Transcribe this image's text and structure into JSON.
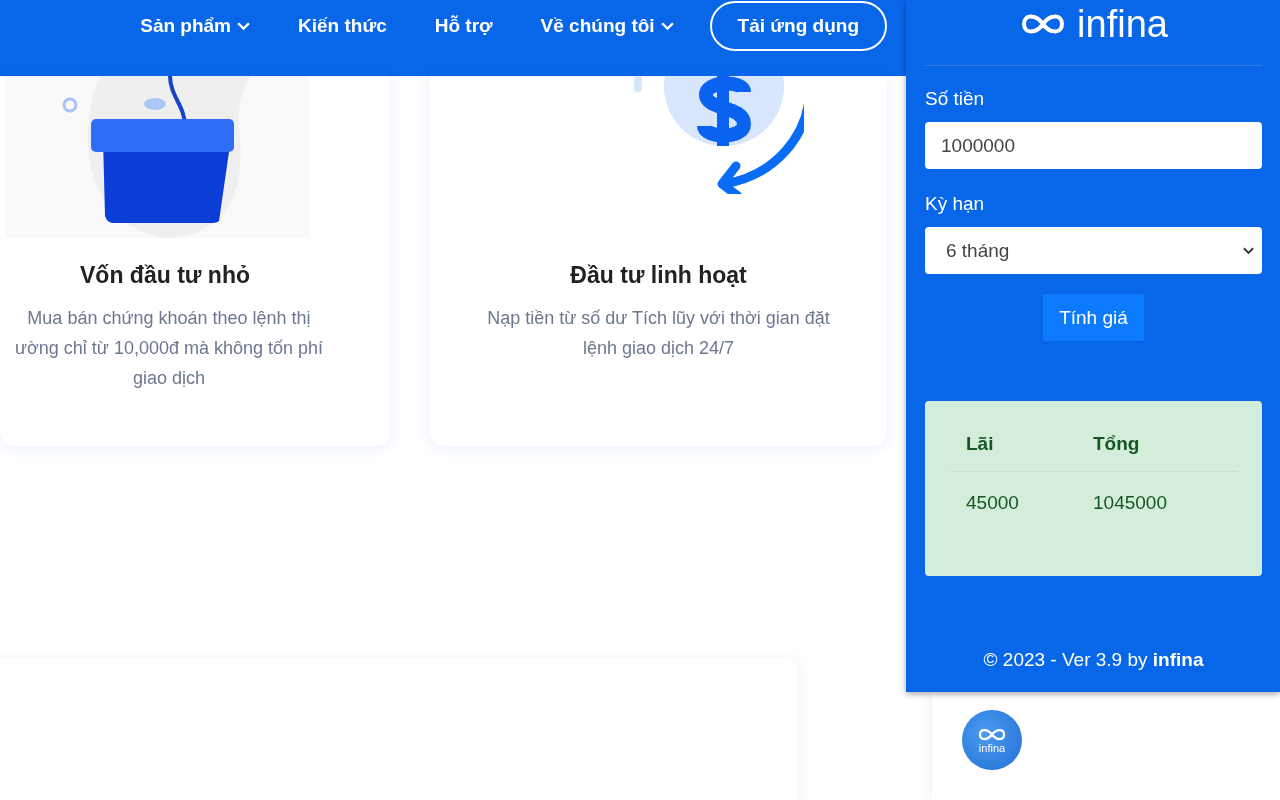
{
  "nav": {
    "items": [
      {
        "label": "Sản phẩm",
        "has_menu": true
      },
      {
        "label": "Kiến thức",
        "has_menu": false
      },
      {
        "label": "Hỗ trợ",
        "has_menu": false
      },
      {
        "label": "Về chúng tôi",
        "has_menu": true
      }
    ],
    "cta": "Tải ứng dụng"
  },
  "features": [
    {
      "kind": "pot",
      "title": "Vốn đầu tư nhỏ",
      "description_lines": [
        "Mua bán chứng khoán theo lệnh thị",
        "ường chỉ từ 10,000đ mà không tốn phí",
        "giao dịch"
      ]
    },
    {
      "kind": "coin",
      "title": "Đầu tư linh hoạt",
      "description_lines": [
        "Nạp tiền từ số dư Tích lũy với thời gian đặt",
        "lệnh giao dịch 24/7"
      ]
    }
  ],
  "avatar": {
    "label": "infina"
  },
  "calculator": {
    "brand": "infina",
    "amount": {
      "label": "Số tiền",
      "value": "1000000"
    },
    "term": {
      "label": "Kỳ hạn",
      "value": "6 tháng"
    },
    "submit": "Tính giá",
    "result": {
      "columns": [
        "Lãi",
        "Tổng"
      ],
      "rows": [
        [
          "45000",
          "1045000"
        ]
      ]
    },
    "footer": "© 2023 - Ver 3.9 by **infina**"
  }
}
